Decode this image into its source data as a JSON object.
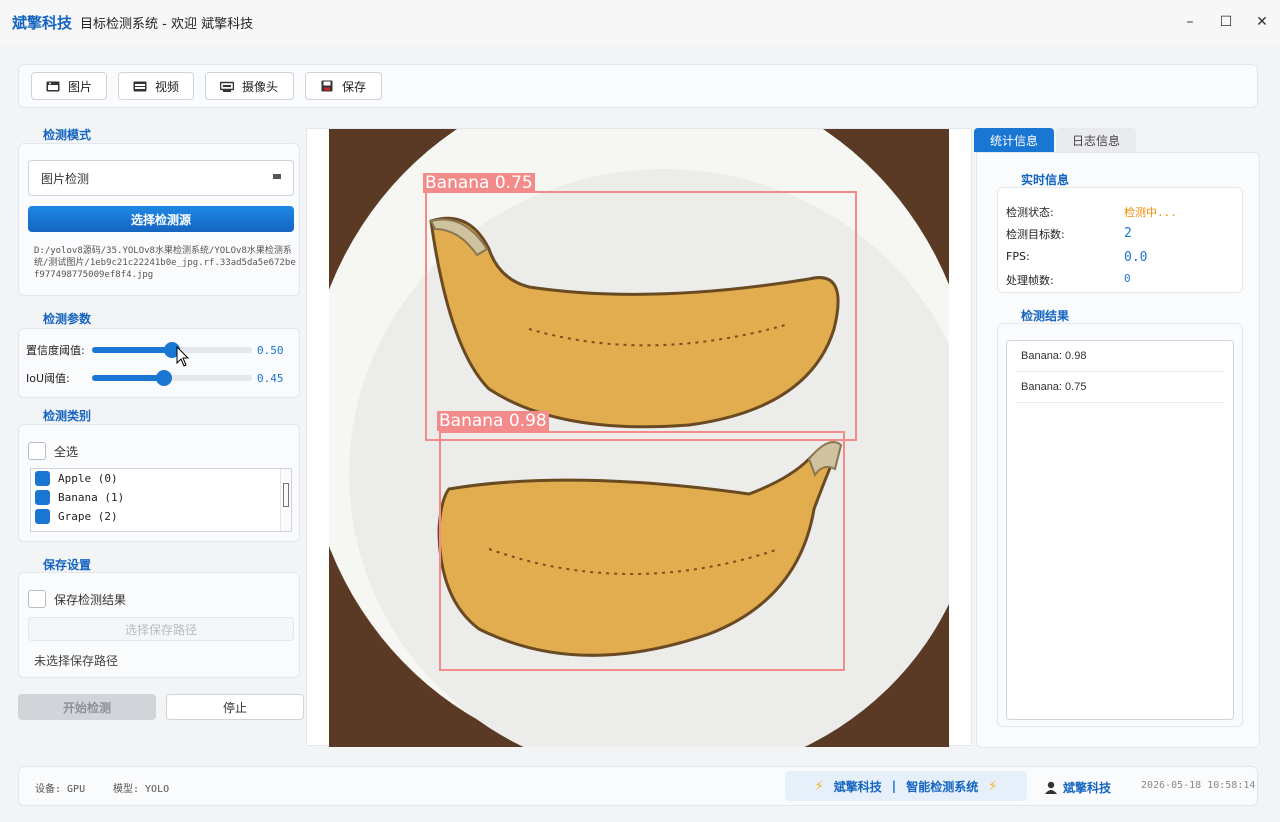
{
  "window": {
    "brand": "斌擎科技",
    "title": "目标检测系统 - 欢迎 斌擎科技",
    "controls": {
      "minimize": "–",
      "maximize": "☐",
      "close": "✕"
    }
  },
  "toolbar": {
    "image_label": "图片",
    "video_label": "视频",
    "camera_label": "摄像头",
    "save_label": "保存"
  },
  "left": {
    "mode_title": "检测模式",
    "mode_value": "图片检测",
    "select_source_label": "选择检测源",
    "source_path": "D:/yolov8源码/35.YOLOv8水果检测系统/YOLOv8水果检测系统/测试图片/1eb9c21c22241b0e_jpg.rf.33ad5da5e672bef977498775009ef8f4.jpg",
    "params_title": "检测参数",
    "confidence_label": "置信度阈值:",
    "confidence_value": "0.50",
    "iou_label": "IoU阈值:",
    "iou_value": "0.45",
    "classes_title": "检测类别",
    "select_all_label": "全选",
    "classes": [
      "Apple (0)",
      "Banana (1)",
      "Grape (2)"
    ],
    "save_title": "保存设置",
    "save_result_label": "保存检测结果",
    "choose_save_path_label": "选择保存路径",
    "save_path_status": "未选择保存路径",
    "start_label": "开始检测",
    "stop_label": "停止"
  },
  "viewer": {
    "detections": [
      {
        "label": "Banana 0.75",
        "confidence": 0.75
      },
      {
        "label": "Banana 0.98",
        "confidence": 0.98
      }
    ]
  },
  "right": {
    "tab_stats": "统计信息",
    "tab_log": "日志信息",
    "realtime_title": "实时信息",
    "status_label": "检测状态:",
    "status_value": "检测中...",
    "count_label": "检测目标数:",
    "count_value": "2",
    "fps_label": "FPS:",
    "fps_value": "0.0",
    "frames_label": "处理帧数:",
    "frames_value": "0",
    "results_title": "检测结果",
    "results": [
      "Banana: 0.98",
      "Banana: 0.75"
    ]
  },
  "statusbar": {
    "device": "设备: GPU",
    "model": "模型: YOLO",
    "brand_left": "斌擎科技",
    "brand_sep": "|",
    "brand_right": "智能检测系统",
    "user": "斌擎科技",
    "datetime": "2026-05-18 10:58:14"
  },
  "colors": {
    "accent": "#1976d2",
    "status_orange": "#f08c00",
    "box": "#f48b8b"
  },
  "slider_levels": {
    "confidence": 0.5,
    "iou": 0.45
  }
}
